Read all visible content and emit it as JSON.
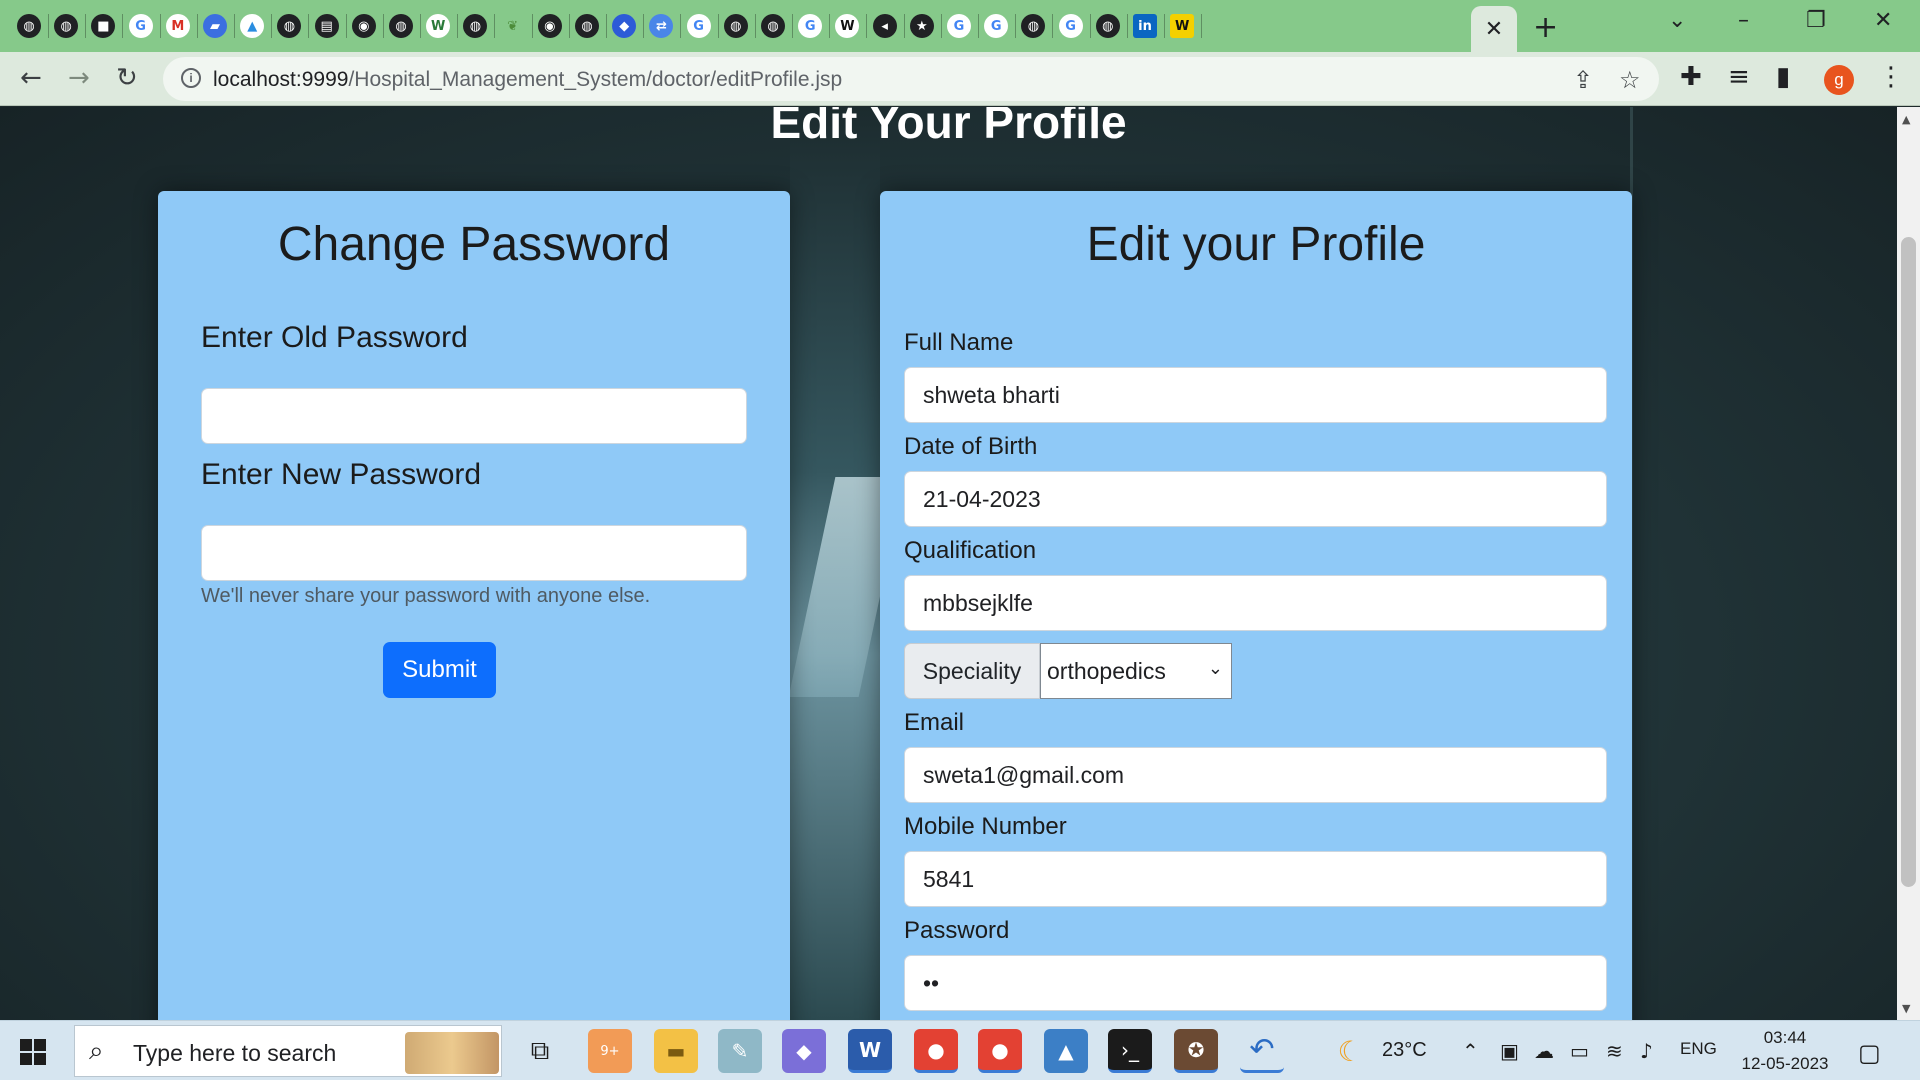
{
  "browser": {
    "url_host": "localhost:9999",
    "url_path": "/Hospital_Management_System/doctor/editProfile.jsp",
    "tab_favicons": [
      "globe-icon",
      "globe-icon",
      "square-icon",
      "google-icon",
      "gmail-icon",
      "chat-icon",
      "triangle-icon",
      "globe-icon",
      "doc-icon",
      "github-icon",
      "globe-icon",
      "w-icon",
      "globe-icon",
      "leaf-icon",
      "github-icon",
      "globe-icon",
      "diamond-icon",
      "translate-icon",
      "google-icon",
      "globe-icon",
      "globe-icon",
      "google-icon",
      "wikipedia-icon",
      "audio-icon",
      "star-icon",
      "google-icon",
      "google-icon",
      "globe-icon",
      "google-icon",
      "globe-icon",
      "linkedin-icon",
      "w-yellow-icon"
    ],
    "profile_initial": "g"
  },
  "page": {
    "heading": "Edit Your Profile"
  },
  "password_card": {
    "title": "Change Password",
    "old_label": "Enter Old Password",
    "old_value": "",
    "new_label": "Enter New Password",
    "new_value": "",
    "hint": "We'll never share your password with anyone else.",
    "submit_label": "Submit"
  },
  "profile_card": {
    "title": "Edit your Profile",
    "fullname_label": "Full Name",
    "fullname_value": "shweta bharti",
    "dob_label": "Date of Birth",
    "dob_value": "21-04-2023",
    "qualification_label": "Qualification",
    "qualification_value": "mbbsejklfe",
    "speciality_label": "Speciality",
    "speciality_value": "orthopedics",
    "email_label": "Email",
    "email_value": "sweta1@gmail.com",
    "mobile_label": "Mobile Number",
    "mobile_value": "5841",
    "password_label": "Password",
    "password_value": "••"
  },
  "taskbar": {
    "search_placeholder": "Type here to search",
    "weather": "23°C",
    "language": "ENG",
    "time": "03:44",
    "date": "12-05-2023",
    "discord_badge": "9+"
  },
  "colors": {
    "card": "#8fc9f7",
    "primary": "#0d6efd",
    "tabstrip": "#86c98a"
  }
}
